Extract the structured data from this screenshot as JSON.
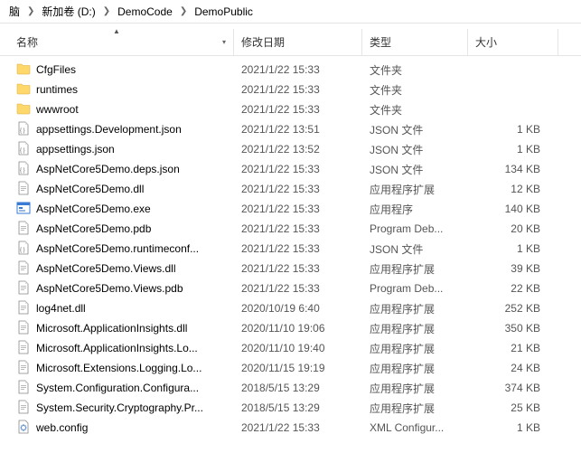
{
  "breadcrumb": {
    "items": [
      "脑",
      "新加卷 (D:)",
      "DemoCode",
      "DemoPublic"
    ]
  },
  "columns": {
    "name": "名称",
    "date": "修改日期",
    "type": "类型",
    "size": "大小"
  },
  "icons": {
    "folder": "folder",
    "json": "file-json",
    "dll": "file-dll",
    "exe": "file-exe",
    "pdb": "file",
    "config": "file-config"
  },
  "files": [
    {
      "name": "CfgFiles",
      "date": "2021/1/22 15:33",
      "type": "文件夹",
      "size": "",
      "icon": "folder"
    },
    {
      "name": "runtimes",
      "date": "2021/1/22 15:33",
      "type": "文件夹",
      "size": "",
      "icon": "folder"
    },
    {
      "name": "wwwroot",
      "date": "2021/1/22 15:33",
      "type": "文件夹",
      "size": "",
      "icon": "folder"
    },
    {
      "name": "appsettings.Development.json",
      "date": "2021/1/22 13:51",
      "type": "JSON 文件",
      "size": "1 KB",
      "icon": "json"
    },
    {
      "name": "appsettings.json",
      "date": "2021/1/22 13:52",
      "type": "JSON 文件",
      "size": "1 KB",
      "icon": "json"
    },
    {
      "name": "AspNetCore5Demo.deps.json",
      "date": "2021/1/22 15:33",
      "type": "JSON 文件",
      "size": "134 KB",
      "icon": "json"
    },
    {
      "name": "AspNetCore5Demo.dll",
      "date": "2021/1/22 15:33",
      "type": "应用程序扩展",
      "size": "12 KB",
      "icon": "dll"
    },
    {
      "name": "AspNetCore5Demo.exe",
      "date": "2021/1/22 15:33",
      "type": "应用程序",
      "size": "140 KB",
      "icon": "exe"
    },
    {
      "name": "AspNetCore5Demo.pdb",
      "date": "2021/1/22 15:33",
      "type": "Program Deb...",
      "size": "20 KB",
      "icon": "pdb"
    },
    {
      "name": "AspNetCore5Demo.runtimeconf...",
      "date": "2021/1/22 15:33",
      "type": "JSON 文件",
      "size": "1 KB",
      "icon": "json"
    },
    {
      "name": "AspNetCore5Demo.Views.dll",
      "date": "2021/1/22 15:33",
      "type": "应用程序扩展",
      "size": "39 KB",
      "icon": "dll"
    },
    {
      "name": "AspNetCore5Demo.Views.pdb",
      "date": "2021/1/22 15:33",
      "type": "Program Deb...",
      "size": "22 KB",
      "icon": "pdb"
    },
    {
      "name": "log4net.dll",
      "date": "2020/10/19 6:40",
      "type": "应用程序扩展",
      "size": "252 KB",
      "icon": "dll"
    },
    {
      "name": "Microsoft.ApplicationInsights.dll",
      "date": "2020/11/10 19:06",
      "type": "应用程序扩展",
      "size": "350 KB",
      "icon": "dll"
    },
    {
      "name": "Microsoft.ApplicationInsights.Lo...",
      "date": "2020/11/10 19:40",
      "type": "应用程序扩展",
      "size": "21 KB",
      "icon": "dll"
    },
    {
      "name": "Microsoft.Extensions.Logging.Lo...",
      "date": "2020/11/15 19:19",
      "type": "应用程序扩展",
      "size": "24 KB",
      "icon": "dll"
    },
    {
      "name": "System.Configuration.Configura...",
      "date": "2018/5/15 13:29",
      "type": "应用程序扩展",
      "size": "374 KB",
      "icon": "dll"
    },
    {
      "name": "System.Security.Cryptography.Pr...",
      "date": "2018/5/15 13:29",
      "type": "应用程序扩展",
      "size": "25 KB",
      "icon": "dll"
    },
    {
      "name": "web.config",
      "date": "2021/1/22 15:33",
      "type": "XML Configur...",
      "size": "1 KB",
      "icon": "config"
    }
  ]
}
